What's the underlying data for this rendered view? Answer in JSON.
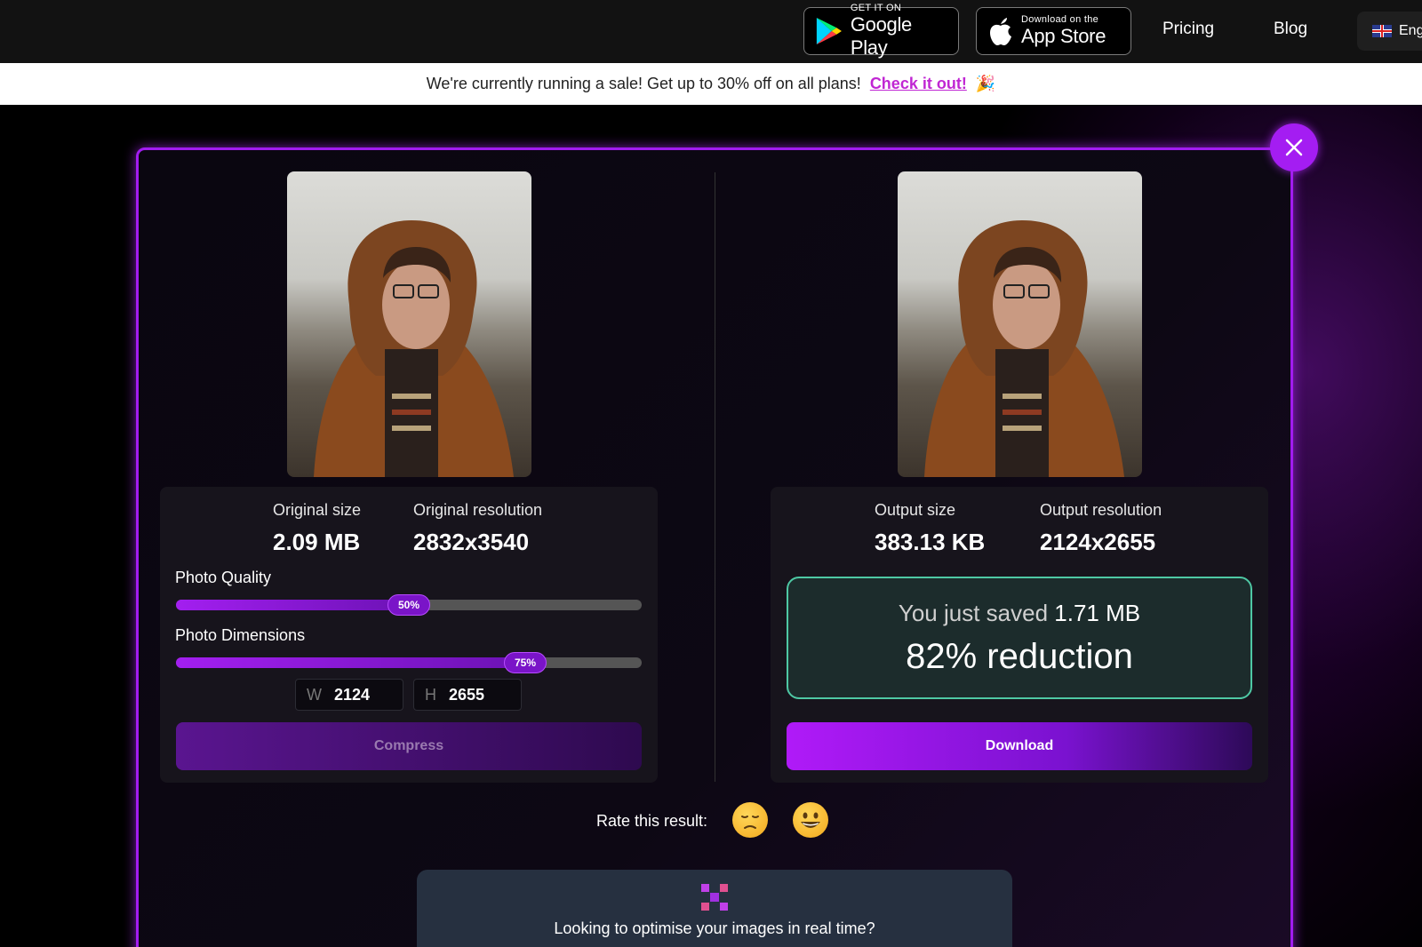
{
  "nav": {
    "google_play": {
      "small": "GET IT ON",
      "big": "Google Play"
    },
    "app_store": {
      "small": "Download on the",
      "big": "App Store"
    },
    "pricing": "Pricing",
    "blog": "Blog",
    "language": "Eng"
  },
  "promo": {
    "text": "We're currently running a sale! Get up to 30% off on all plans!",
    "cta": "Check it out!",
    "emoji": "🎉"
  },
  "original": {
    "size_label": "Original size",
    "size_value": "2.09 MB",
    "resolution_label": "Original resolution",
    "resolution_value": "2832x3540",
    "quality_label": "Photo Quality",
    "quality_percent": 50,
    "quality_text": "50%",
    "dimensions_label": "Photo Dimensions",
    "dimensions_percent": 75,
    "dimensions_text": "75%",
    "width_label": "W",
    "width_value": "2124",
    "height_label": "H",
    "height_value": "2655",
    "compress_label": "Compress"
  },
  "output": {
    "size_label": "Output size",
    "size_value": "383.13 KB",
    "resolution_label": "Output resolution",
    "resolution_value": "2124x2655",
    "saved_prefix": "You just saved",
    "saved_amount": "1.71 MB",
    "reduction": "82% reduction",
    "download_label": "Download"
  },
  "rating": {
    "label": "Rate this result:",
    "sad": "😔",
    "happy": "😀"
  },
  "realtime": {
    "text": "Looking to optimise your images in real time?"
  },
  "colors": {
    "accent": "#a21cf0",
    "saved_border": "#4ec8a4",
    "cta": "#c026d3"
  }
}
